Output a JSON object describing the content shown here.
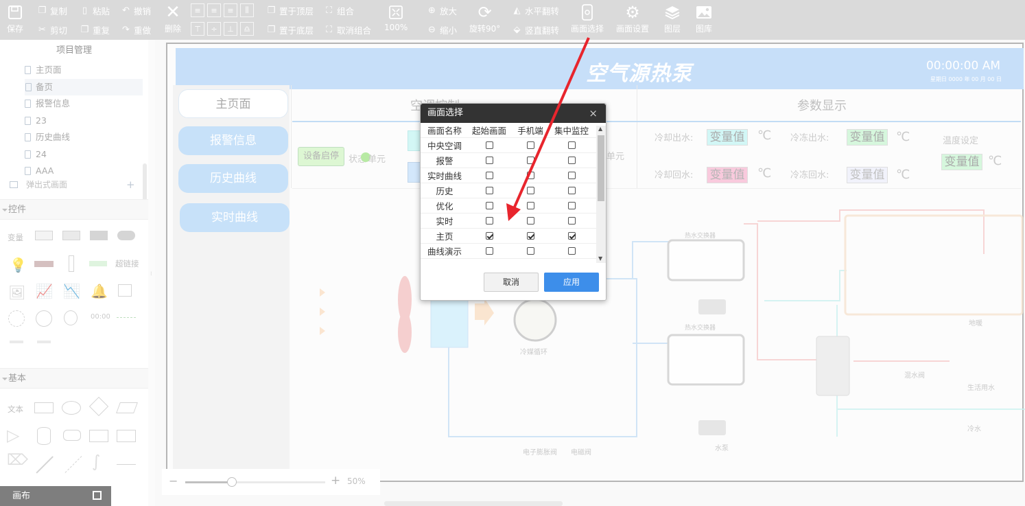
{
  "toolbar": {
    "save": "保存",
    "copy": "复制",
    "cut": "剪切",
    "paste": "粘贴",
    "redo_dup": "重复",
    "undo": "撤销",
    "redo": "重做",
    "delete": "删除",
    "bring_top": "置于顶层",
    "send_bottom": "置于底层",
    "group": "组合",
    "ungroup": "取消组合",
    "zoom_level": "100%",
    "zoom_in": "放大",
    "zoom_out": "缩小",
    "rotate": "旋转90°",
    "flip_h": "水平翻转",
    "flip_v": "竖直翻转",
    "screen_select": "画面选择",
    "screen_settings": "画面设置",
    "layers": "图层",
    "gallery": "图库"
  },
  "sidebar": {
    "title": "项目管理",
    "items": [
      "主页面",
      "备页",
      "报警信息",
      "23",
      "历史曲线",
      "24",
      "AAA"
    ],
    "popup_item": "弹出式画面",
    "controls_title": "控件",
    "var_label": "变量",
    "hyperlink_label": "超链接",
    "clock_value": "00:00",
    "basic_title": "基本",
    "text_label": "文本",
    "canvas_label": "画布"
  },
  "page": {
    "title": "空气源热泵",
    "clock": "00:00:00 AM",
    "date": "星期日    0000 年 00 月 00 日",
    "nav": [
      "主页面",
      "报警信息",
      "历史曲线",
      "实时曲线"
    ],
    "ac_control": "空调控制",
    "param_display": "参数显示",
    "device_btn": "设备启停",
    "status_label": "状态",
    "unit_label": "单元",
    "cool_out_label": "冷却出水:",
    "freeze_out_label": "冷冻出水:",
    "temp_set_label": "温度设定",
    "cool_back_label": "冷却回水:",
    "freeze_back_label": "冷冻回水:",
    "var_value": "变量值",
    "deg_unit": "℃",
    "hot_exchanger_1": "热水交换器",
    "hot_exchanger_2": "热水交换器",
    "refrigerant_cycle": "冷媒循环",
    "floor_heating": "地暖",
    "mix_valve": "混水阀",
    "domestic_water": "生活用水",
    "cold_water": "冷水",
    "pump": "水泵",
    "exp_valve": "电子膨胀阀",
    "solenoid": "电磁阀",
    "colors": {
      "banner": "#a5ccf5",
      "cyan": "#a7f0ef",
      "green": "#b5f2c2",
      "pink": "#f3a4c8",
      "lavender": "#c8cdf0"
    }
  },
  "dialog": {
    "title": "画面选择",
    "close": "×",
    "headers": [
      "画面名称",
      "起始画面",
      "手机端",
      "集中监控"
    ],
    "rows": [
      {
        "name": "中央空调",
        "start": false,
        "mobile": false,
        "central": false
      },
      {
        "name": "报警",
        "start": false,
        "mobile": false,
        "central": false
      },
      {
        "name": "实时曲线",
        "start": false,
        "mobile": false,
        "central": false
      },
      {
        "name": "历史",
        "start": false,
        "mobile": false,
        "central": false
      },
      {
        "name": "优化",
        "start": false,
        "mobile": false,
        "central": false
      },
      {
        "name": "实时",
        "start": false,
        "mobile": false,
        "central": false
      },
      {
        "name": "主页",
        "start": true,
        "mobile": true,
        "central": true
      },
      {
        "name": "曲线演示",
        "start": false,
        "mobile": false,
        "central": false
      }
    ],
    "cancel": "取消",
    "apply": "应用"
  },
  "zoom": {
    "percent": "50%",
    "minus": "−",
    "plus": "+",
    "level": 0.5
  }
}
